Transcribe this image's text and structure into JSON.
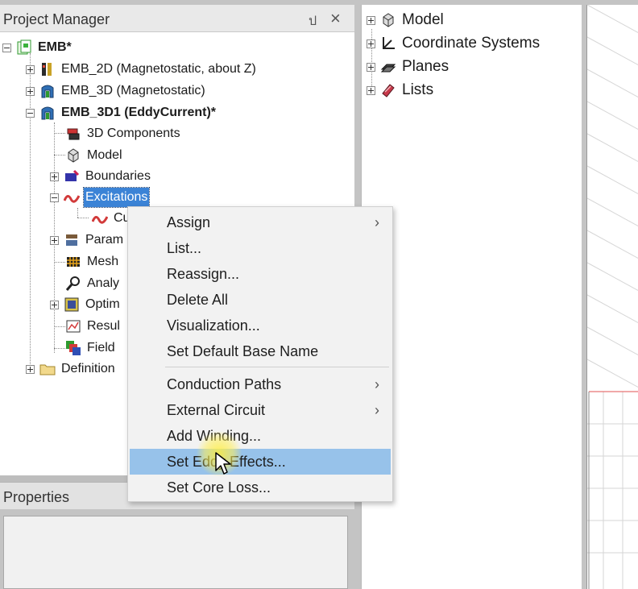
{
  "project_manager": {
    "title": "Project Manager",
    "pin_glyph": "ป",
    "close_glyph": "×",
    "tree": [
      {
        "label": "EMB*",
        "icon": "project-icon",
        "bold": true
      },
      {
        "label": "EMB_2D (Magnetostatic, about Z)",
        "icon": "design-2d-icon"
      },
      {
        "label": "EMB_3D (Magnetostatic)",
        "icon": "design-3d-icon"
      },
      {
        "label": "EMB_3D1 (EddyCurrent)*",
        "icon": "design-3d-icon",
        "bold": true
      },
      {
        "label": "3D Components",
        "icon": "components-icon"
      },
      {
        "label": "Model",
        "icon": "model-icon"
      },
      {
        "label": "Boundaries",
        "icon": "boundaries-icon"
      },
      {
        "label": "Excitations",
        "icon": "excitations-icon",
        "selected": true
      },
      {
        "label": "Cu",
        "icon": "excitation-item-icon"
      },
      {
        "label": "Param",
        "icon": "parameters-icon"
      },
      {
        "label": "Mesh",
        "icon": "mesh-icon"
      },
      {
        "label": "Analy",
        "icon": "analysis-icon"
      },
      {
        "label": "Optim",
        "icon": "optimetrics-icon"
      },
      {
        "label": "Resul",
        "icon": "results-icon"
      },
      {
        "label": "Field",
        "icon": "field-overlays-icon"
      },
      {
        "label": "Definition",
        "icon": "folder-icon"
      }
    ]
  },
  "properties": {
    "title": "Properties"
  },
  "model_tree": [
    {
      "label": "Model",
      "icon": "model-icon"
    },
    {
      "label": "Coordinate Systems",
      "icon": "coordinate-systems-icon"
    },
    {
      "label": "Planes",
      "icon": "planes-icon"
    },
    {
      "label": "Lists",
      "icon": "lists-icon"
    }
  ],
  "context_menu": {
    "arrow_glyph": "›",
    "items": [
      {
        "label": "Assign",
        "submenu": true
      },
      {
        "label": "List..."
      },
      {
        "label": "Reassign..."
      },
      {
        "label": "Delete All"
      },
      {
        "label": "Visualization..."
      },
      {
        "label": "Set Default Base Name"
      },
      {
        "label": "Conduction Paths",
        "submenu": true
      },
      {
        "label": "External Circuit",
        "submenu": true
      },
      {
        "label": "Add Winding..."
      },
      {
        "label": "Set Eddy Effects...",
        "highlighted": true
      },
      {
        "label": "Set Core Loss..."
      }
    ]
  },
  "colors": {
    "selection": "#3b83d6",
    "menu_highlight": "#97c2ea",
    "cursor_highlight": "#ffee3c"
  }
}
